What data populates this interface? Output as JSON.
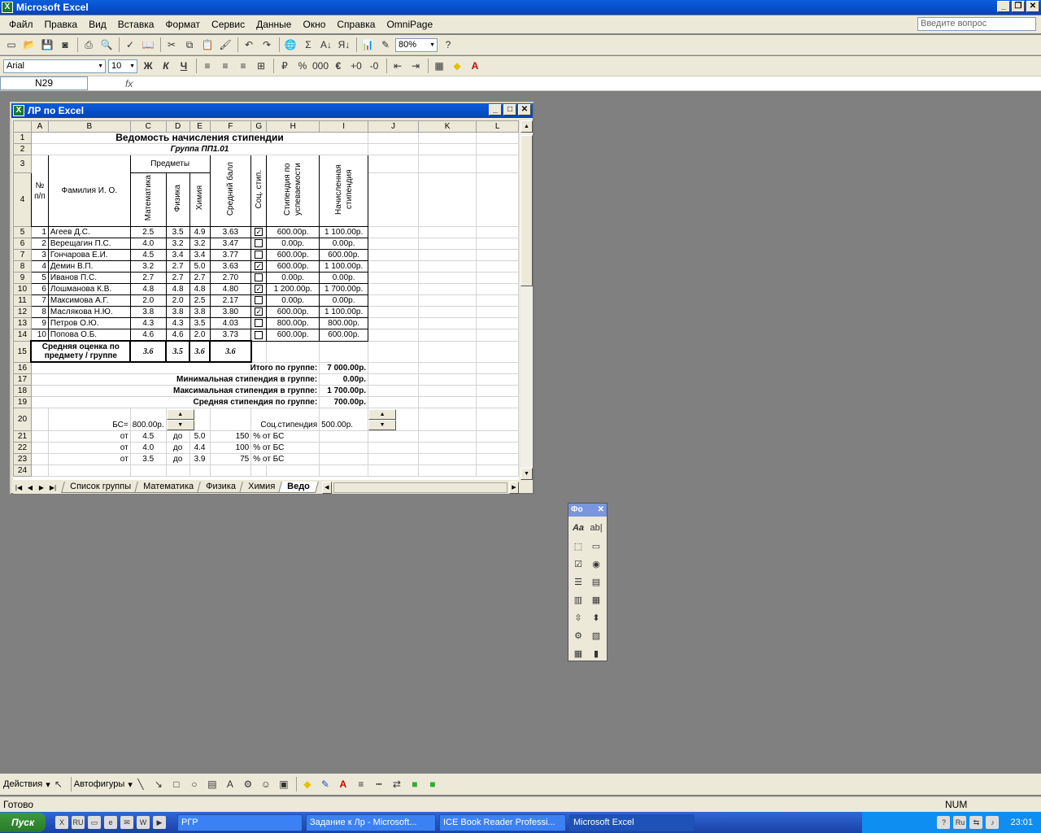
{
  "app": {
    "title": "Microsoft Excel"
  },
  "menu": {
    "items": [
      "Файл",
      "Правка",
      "Вид",
      "Вставка",
      "Формат",
      "Сервис",
      "Данные",
      "Окно",
      "Справка",
      "OmniPage"
    ],
    "help_placeholder": "Введите вопрос"
  },
  "toolbar": {
    "zoom": "80%",
    "font": "Arial",
    "size": "10"
  },
  "formula": {
    "namebox": "N29",
    "fx": "fx"
  },
  "workbook": {
    "title": "ЛР по Excel"
  },
  "columns": [
    "A",
    "B",
    "C",
    "D",
    "E",
    "F",
    "G",
    "H",
    "I",
    "J",
    "K",
    "L"
  ],
  "sheet": {
    "title": "Ведомость начисления стипендии",
    "group_label": "Группа  ПП1.01",
    "hdr_num": "№ п/п",
    "hdr_name": "Фамилия И. О.",
    "hdr_subjects": "Предметы",
    "hdr_math": "Математика",
    "hdr_phys": "Физика",
    "hdr_chem": "Химия",
    "hdr_avg": "Средний балл",
    "hdr_soc": "Соц. стип.",
    "hdr_perf": "Стипендия по успеваемости",
    "hdr_total": "Начисленная стипендия",
    "students": [
      {
        "n": "1",
        "name": "Агеев Д.С.",
        "m": "2.5",
        "p": "3.5",
        "c": "4.9",
        "avg": "3.63",
        "soc": "✓",
        "perf": "600.00р.",
        "tot": "1 100.00р."
      },
      {
        "n": "2",
        "name": "Верещагин П.С.",
        "m": "4.0",
        "p": "3.2",
        "c": "3.2",
        "avg": "3.47",
        "soc": "",
        "perf": "0.00р.",
        "tot": "0.00р."
      },
      {
        "n": "3",
        "name": "Гончарова Е.И.",
        "m": "4.5",
        "p": "3.4",
        "c": "3.4",
        "avg": "3.77",
        "soc": "",
        "perf": "600.00р.",
        "tot": "600.00р."
      },
      {
        "n": "4",
        "name": "Демин В.П.",
        "m": "3.2",
        "p": "2.7",
        "c": "5.0",
        "avg": "3.63",
        "soc": "✓",
        "perf": "600.00р.",
        "tot": "1 100.00р."
      },
      {
        "n": "5",
        "name": "Иванов П.С.",
        "m": "2.7",
        "p": "2.7",
        "c": "2.7",
        "avg": "2.70",
        "soc": "",
        "perf": "0.00р.",
        "tot": "0.00р."
      },
      {
        "n": "6",
        "name": "Лошманова К.В.",
        "m": "4.8",
        "p": "4.8",
        "c": "4.8",
        "avg": "4.80",
        "soc": "✓",
        "perf": "1 200.00р.",
        "tot": "1 700.00р."
      },
      {
        "n": "7",
        "name": "Максимова А.Г.",
        "m": "2.0",
        "p": "2.0",
        "c": "2.5",
        "avg": "2.17",
        "soc": "",
        "perf": "0.00р.",
        "tot": "0.00р."
      },
      {
        "n": "8",
        "name": "Маслякова Н.Ю.",
        "m": "3.8",
        "p": "3.8",
        "c": "3.8",
        "avg": "3.80",
        "soc": "✓",
        "perf": "600.00р.",
        "tot": "1 100.00р."
      },
      {
        "n": "9",
        "name": "Петров О.Ю.",
        "m": "4.3",
        "p": "4.3",
        "c": "3.5",
        "avg": "4.03",
        "soc": "",
        "perf": "800.00р.",
        "tot": "800.00р."
      },
      {
        "n": "10",
        "name": "Попова О.Б.",
        "m": "4.6",
        "p": "4.6",
        "c": "2.0",
        "avg": "3.73",
        "soc": "",
        "perf": "600.00р.",
        "tot": "600.00р."
      }
    ],
    "avg_label": "Средняя оценка по предмету / группе",
    "avg_m": "3.6",
    "avg_p": "3.5",
    "avg_c": "3.6",
    "avg_all": "3.6",
    "total_label": "Итого по группе:",
    "total_val": "7 000.00р.",
    "min_label": "Минимальная стипендия в группе:",
    "min_val": "0.00р.",
    "max_label": "Максимальная стипендия в группе:",
    "max_val": "1 700.00р.",
    "mean_label": "Средняя стипендия по группе:",
    "mean_val": "700.00р.",
    "bs_label": "БС=",
    "bs_val": "800.00р.",
    "soc_label": "Соц.стипендия",
    "soc_val": "500.00р.",
    "ranges": [
      {
        "from": "от",
        "a": "4.5",
        "to": "до",
        "b": "5.0",
        "pct": "150",
        "unit": "% от БС"
      },
      {
        "from": "от",
        "a": "4.0",
        "to": "до",
        "b": "4.4",
        "pct": "100",
        "unit": "% от БС"
      },
      {
        "from": "от",
        "a": "3.5",
        "to": "до",
        "b": "3.9",
        "pct": "75",
        "unit": "% от БС"
      }
    ]
  },
  "tabs": [
    "Список группы",
    "Математика",
    "Физика",
    "Химия",
    "Ведо"
  ],
  "forms": {
    "title": "Фо"
  },
  "drawing": {
    "actions": "Действия",
    "autoshapes": "Автофигуры"
  },
  "status": {
    "ready": "Готово",
    "num": "NUM"
  },
  "taskbar": {
    "start": "Пуск",
    "tasks": [
      "РГР",
      "Задание к Лр - Microsoft...",
      "ICE Book Reader Professi...",
      "Microsoft Excel"
    ],
    "clock": "23:01"
  }
}
